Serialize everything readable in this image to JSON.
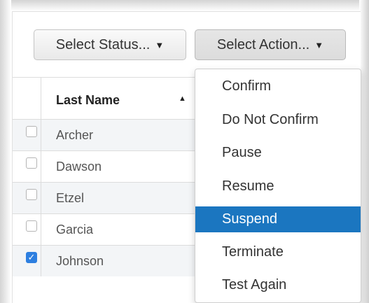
{
  "toolbar": {
    "status_label": "Select Status...",
    "action_label": "Select Action..."
  },
  "table": {
    "header": "Last Name",
    "rows": [
      {
        "name": "Archer",
        "checked": false
      },
      {
        "name": "Dawson",
        "checked": false
      },
      {
        "name": "Etzel",
        "checked": false
      },
      {
        "name": "Garcia",
        "checked": false
      },
      {
        "name": "Johnson",
        "checked": true
      }
    ]
  },
  "action_menu": {
    "items": [
      {
        "label": "Confirm"
      },
      {
        "label": "Do Not Confirm"
      },
      {
        "label": "Pause"
      },
      {
        "label": "Resume"
      },
      {
        "label": "Suspend",
        "active": true
      },
      {
        "label": "Terminate"
      },
      {
        "label": "Test Again"
      }
    ]
  },
  "colors": {
    "highlight": "#1b76c0",
    "checkbox_checked": "#2d7fe0"
  },
  "icons": {
    "caret": "caret-down-icon",
    "sort": "sort-ascending-icon",
    "checkmark": "checkmark-icon"
  }
}
